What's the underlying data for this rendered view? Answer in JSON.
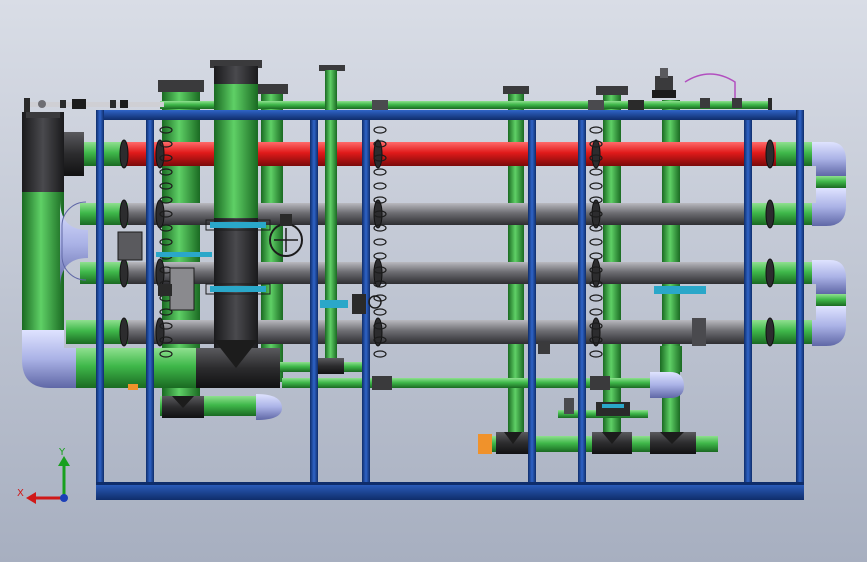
{
  "viewport": {
    "background_top": "#d9dde6",
    "background_bottom": "#a7afc0"
  },
  "colors": {
    "frame_blue": "#1f4ea8",
    "frame_blue_dark": "#0f2d6b",
    "pipe_red": "#e01a1a",
    "pipe_green": "#3fb84a",
    "pipe_gray": "#6e6e73",
    "pipe_dark": "#2c2c2e",
    "elbow_lavender": "#aab2e6",
    "valve_cyan": "#2aa7c9",
    "flange_orange": "#f0922b",
    "accent_purple": "#b24fbf"
  },
  "icons": {
    "triad": "coordinate-triad-icon"
  },
  "triad": {
    "x_label": "X",
    "y_label": "Y",
    "x_color": "#d01818",
    "y_color": "#18a01e",
    "z_color": "#1c3fb8"
  }
}
